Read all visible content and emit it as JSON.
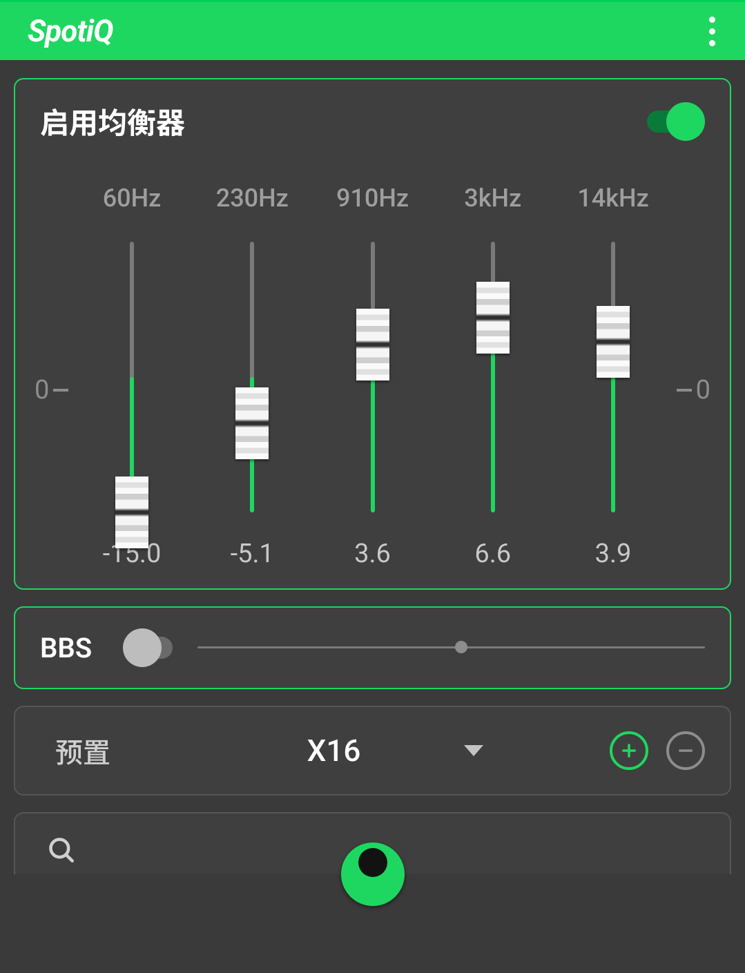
{
  "app": {
    "title": "SpotiQ"
  },
  "eq": {
    "title": "启用均衡器",
    "enabled": true,
    "range": {
      "min": -15,
      "max": 15
    },
    "zero_left": "0",
    "zero_right": "0",
    "bands": [
      {
        "freq": "60Hz",
        "value": -15.0,
        "value_text": "-15.0"
      },
      {
        "freq": "230Hz",
        "value": -5.1,
        "value_text": "-5.1"
      },
      {
        "freq": "910Hz",
        "value": 3.6,
        "value_text": "3.6"
      },
      {
        "freq": "3kHz",
        "value": 6.6,
        "value_text": "6.6"
      },
      {
        "freq": "14kHz",
        "value": 3.9,
        "value_text": "3.9"
      }
    ]
  },
  "bbs": {
    "label": "BBS",
    "enabled": false,
    "slider_percent": 52
  },
  "preset": {
    "label": "预置",
    "selected": "X16"
  },
  "colors": {
    "accent": "#1ed760",
    "bg": "#3a3a3a",
    "card": "#3f3f3f"
  },
  "icons": {
    "overflow": "more-vert-icon",
    "add": "plus-circle-icon",
    "remove": "minus-circle-icon",
    "dropdown": "chevron-down-icon",
    "search": "search-icon",
    "play": "play-circle-icon"
  }
}
